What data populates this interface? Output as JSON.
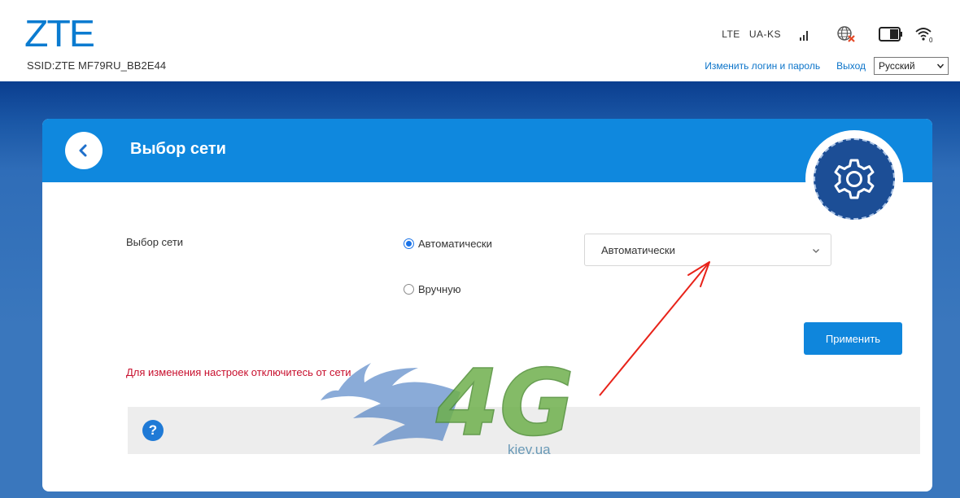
{
  "header": {
    "logo": "ZTE",
    "ssid": "SSID:ZTE MF79RU_BB2E44",
    "status": {
      "network_type": "LTE",
      "operator": "UA-KS",
      "wifi_clients": "0"
    },
    "links": {
      "change_login": "Изменить логин и пароль",
      "logout": "Выход"
    },
    "language": "Русский"
  },
  "page": {
    "title": "Выбор сети",
    "field_label": "Выбор сети",
    "radio_auto": "Автоматически",
    "radio_manual": "Вручную",
    "selected_mode": "auto",
    "select_value": "Автоматически",
    "apply": "Применить",
    "warning": "Для изменения настроек отключитесь от сети",
    "help": "?"
  },
  "watermark": {
    "logo": "4G",
    "site": "kiev.ua"
  },
  "colors": {
    "brand": "#0a7bd0",
    "header_band": "#0f88de",
    "background": "#3a77bd",
    "warning": "#c8102e",
    "button": "#0f86dc",
    "arrow": "#e8231a"
  }
}
